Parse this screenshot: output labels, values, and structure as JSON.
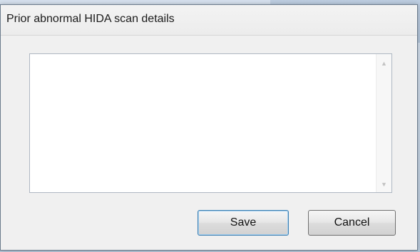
{
  "dialog": {
    "title": "Prior abnormal HIDA scan details"
  },
  "details_field": {
    "value": "",
    "placeholder": ""
  },
  "scrollbar": {
    "up_glyph": "▲",
    "down_glyph": "▼"
  },
  "buttons": {
    "save_label": "Save",
    "cancel_label": "Cancel"
  }
}
